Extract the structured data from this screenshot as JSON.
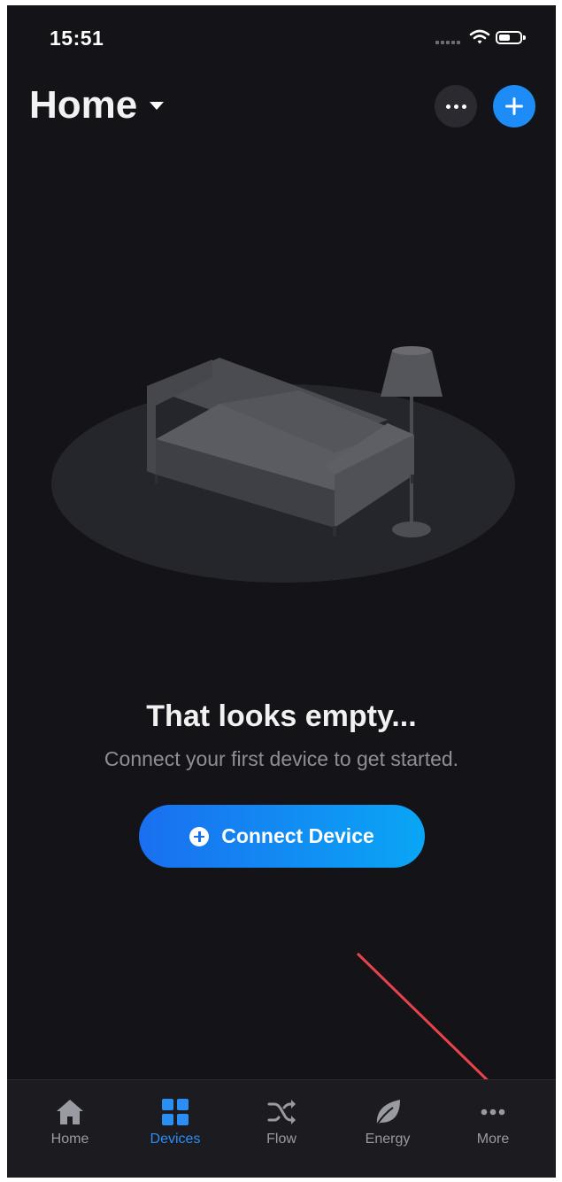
{
  "status_bar": {
    "time": "15:51"
  },
  "header": {
    "title": "Home"
  },
  "empty_state": {
    "title": "That looks empty...",
    "subtitle": "Connect your first device to get started.",
    "button_label": "Connect Device"
  },
  "tabs": [
    {
      "label": "Home",
      "icon": "home-icon",
      "active": false
    },
    {
      "label": "Devices",
      "icon": "grid-icon",
      "active": true
    },
    {
      "label": "Flow",
      "icon": "shuffle-icon",
      "active": false
    },
    {
      "label": "Energy",
      "icon": "leaf-icon",
      "active": false
    },
    {
      "label": "More",
      "icon": "more-dots-icon",
      "active": false
    }
  ],
  "colors": {
    "background": "#141418",
    "accent": "#1e8cf7",
    "active_tab": "#2b8ef5",
    "annotation_arrow": "#e8434a"
  }
}
